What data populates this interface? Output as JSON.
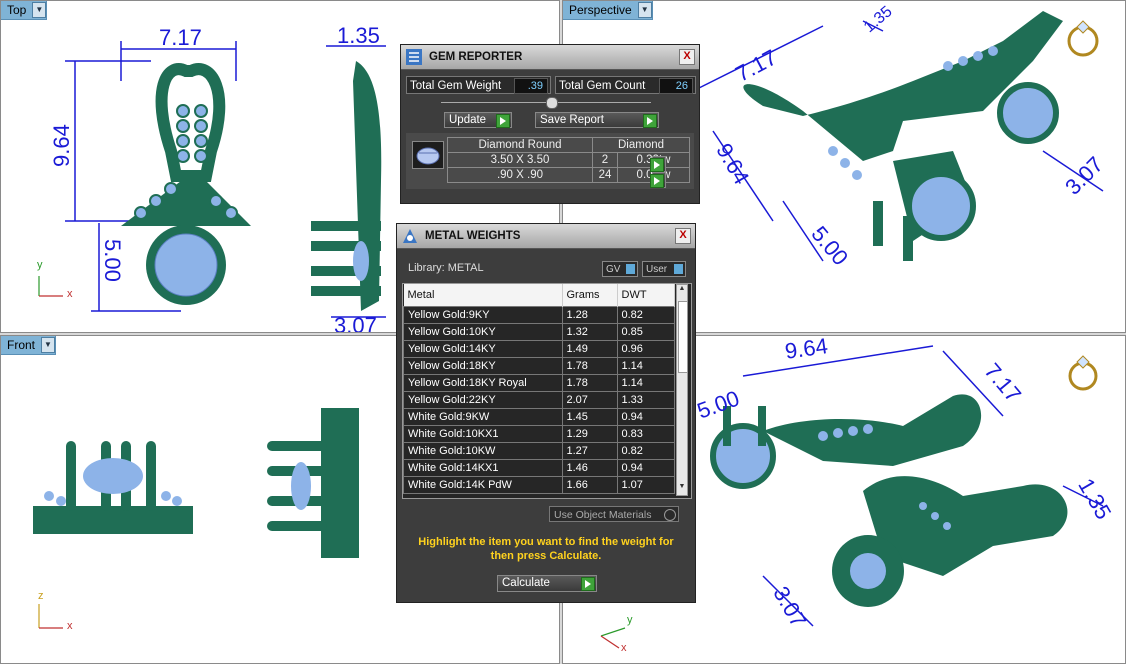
{
  "viewports": {
    "top": {
      "label": "Top",
      "dims": {
        "width": "7.17",
        "height": "9.64",
        "drop": "5.00",
        "side_width": "1.35",
        "side_depth": "3.07"
      },
      "axes": {
        "x": "x",
        "y": "y"
      }
    },
    "perspective": {
      "label": "Perspective",
      "dims": {
        "width": "7.17",
        "height": "9.64",
        "side": "1.35",
        "depth": "3.07",
        "drop": "5.00"
      }
    },
    "front": {
      "label": "Front",
      "axes": {
        "x": "x",
        "z": "z"
      }
    },
    "bottom_right": {
      "dims": {
        "height": "9.64",
        "width": "7.17",
        "side": "1.35",
        "depth": "3.07",
        "drop": "5.00"
      },
      "axes": {
        "x": "x",
        "y": "y"
      }
    }
  },
  "gem_reporter": {
    "title": "GEM REPORTER",
    "close": "X",
    "total_weight_label": "Total Gem Weight",
    "total_weight_value": ".39",
    "total_count_label": "Total Gem Count",
    "total_count_value": "26",
    "update_label": "Update",
    "save_label": "Save Report",
    "header_shape": "Diamond Round",
    "header_type": "Diamond",
    "rows": [
      {
        "size": "3.50 X 3.50",
        "count": "2",
        "weight": "0.32tw"
      },
      {
        "size": ".90 X .90",
        "count": "24",
        "weight": "0.07tw"
      }
    ]
  },
  "metal_weights": {
    "title": "METAL WEIGHTS",
    "close": "X",
    "library_label": "Library: METAL",
    "gv_label": "GV",
    "user_label": "User",
    "columns": [
      "Metal",
      "Grams",
      "DWT"
    ],
    "rows": [
      {
        "metal": "Yellow Gold:9KY",
        "grams": "1.28",
        "dwt": "0.82"
      },
      {
        "metal": "Yellow Gold:10KY",
        "grams": "1.32",
        "dwt": "0.85"
      },
      {
        "metal": "Yellow Gold:14KY",
        "grams": "1.49",
        "dwt": "0.96"
      },
      {
        "metal": "Yellow Gold:18KY",
        "grams": "1.78",
        "dwt": "1.14"
      },
      {
        "metal": "Yellow Gold:18KY Royal",
        "grams": "1.78",
        "dwt": "1.14"
      },
      {
        "metal": "Yellow Gold:22KY",
        "grams": "2.07",
        "dwt": "1.33"
      },
      {
        "metal": "White Gold:9KW",
        "grams": "1.45",
        "dwt": "0.94"
      },
      {
        "metal": "White Gold:10KX1",
        "grams": "1.29",
        "dwt": "0.83"
      },
      {
        "metal": "White Gold:10KW",
        "grams": "1.27",
        "dwt": "0.82"
      },
      {
        "metal": "White Gold:14KX1",
        "grams": "1.46",
        "dwt": "0.94"
      },
      {
        "metal": "White Gold:14K PdW",
        "grams": "1.66",
        "dwt": "1.07"
      }
    ],
    "use_object_materials_label": "Use Object Materials",
    "hint": "Highlight the item you want to find the weight for then press Calculate.",
    "calculate_label": "Calculate"
  },
  "colors": {
    "metal": "#1f6e55",
    "gem": "#8db3e8",
    "dimension": "#1a1ad6",
    "viewport_label": "#7fb3d6",
    "panel": "#3d3d3d",
    "hint": "#ffd21e"
  }
}
